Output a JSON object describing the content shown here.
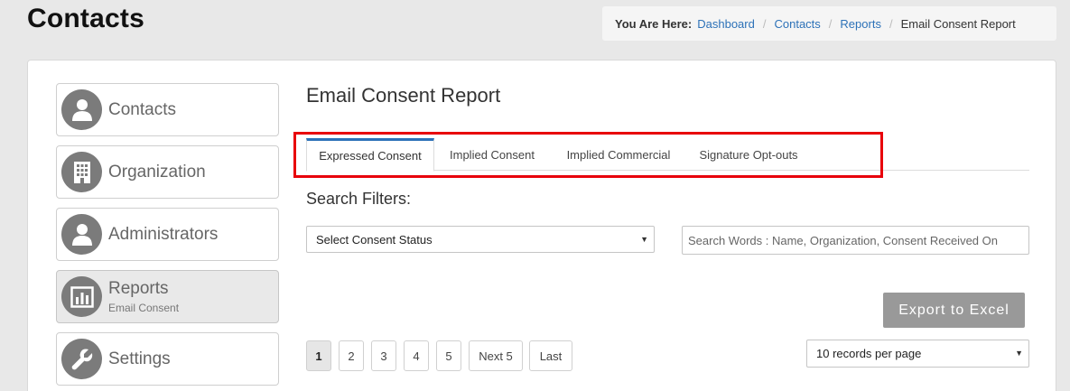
{
  "header": {
    "title": "Contacts"
  },
  "breadcrumb": {
    "label": "You Are Here:",
    "links": [
      "Dashboard",
      "Contacts",
      "Reports"
    ],
    "current": "Email Consent Report"
  },
  "sidebar": {
    "items": [
      {
        "label": "Contacts",
        "sub": "",
        "icon": "user-icon"
      },
      {
        "label": "Organization",
        "sub": "",
        "icon": "building-icon"
      },
      {
        "label": "Administrators",
        "sub": "",
        "icon": "user-icon"
      },
      {
        "label": "Reports",
        "sub": "Email Consent",
        "icon": "bar-chart-icon",
        "active": true
      },
      {
        "label": "Settings",
        "sub": "",
        "icon": "wrench-icon"
      }
    ]
  },
  "main": {
    "title": "Email Consent Report",
    "tabs": [
      {
        "label": "Expressed Consent",
        "active": true
      },
      {
        "label": "Implied Consent"
      },
      {
        "label": "Implied Commercial"
      },
      {
        "label": "Signature Opt-outs"
      }
    ],
    "filters_title": "Search Filters:",
    "status_select": {
      "value": "Select Consent Status"
    },
    "search": {
      "placeholder": "Search Words : Name, Organization, Consent Received On"
    },
    "export_label": "Export to Excel",
    "pagination": [
      "1",
      "2",
      "3",
      "4",
      "5",
      "Next 5",
      "Last"
    ],
    "per_page": {
      "value": "10 records per page"
    }
  },
  "colors": {
    "accent": "#2d72b8",
    "highlight_border": "#e8000b",
    "icon_circle": "#7b7b7b",
    "export_button": "#999999"
  }
}
